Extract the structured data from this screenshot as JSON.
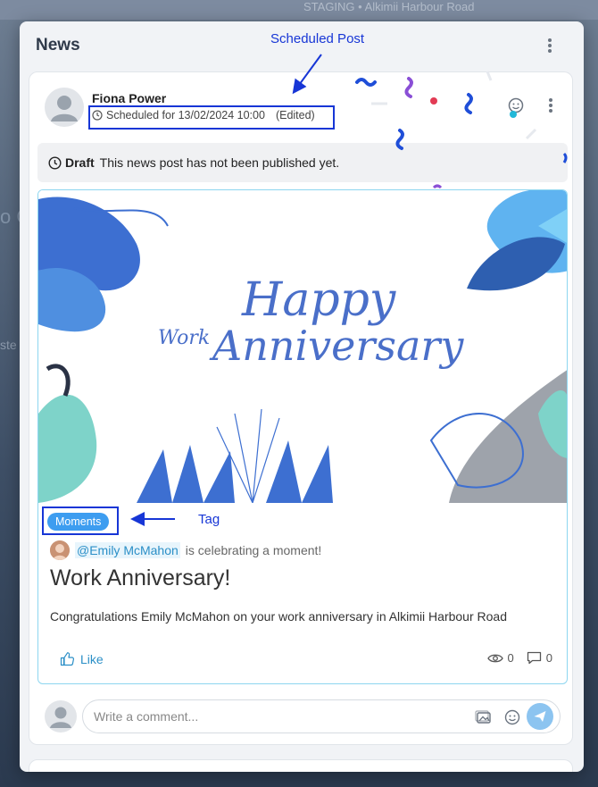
{
  "background": {
    "topbar_text": "STAGING • Alkimii Harbour Road",
    "left_text_1": "o C",
    "left_text_2": "ste"
  },
  "modal": {
    "title": "News"
  },
  "post": {
    "author": "Fiona Power",
    "scheduled_text": "Scheduled for 13/02/2024 10:00",
    "edited_text": "(Edited)",
    "draft_label": "Draft",
    "draft_message": "This news post has not been published yet.",
    "image": {
      "line1": "Happy",
      "line2_prefix": "Work",
      "line2": "Anniversary"
    },
    "tag": "Moments",
    "mention": "@Emily McMahon",
    "celebrate_text": "is celebrating a moment!",
    "title": "Work Anniversary!",
    "body": "Congratulations Emily McMahon on your work anniversary in Alkimii Harbour Road",
    "like_label": "Like",
    "views": "0",
    "comments": "0"
  },
  "comment": {
    "placeholder": "Write a comment..."
  },
  "annotations": {
    "scheduled_post": "Scheduled Post",
    "tag": "Tag"
  },
  "colors": {
    "accent": "#3d9df0",
    "annotation": "#1736d6",
    "link": "#2b8fc7"
  }
}
